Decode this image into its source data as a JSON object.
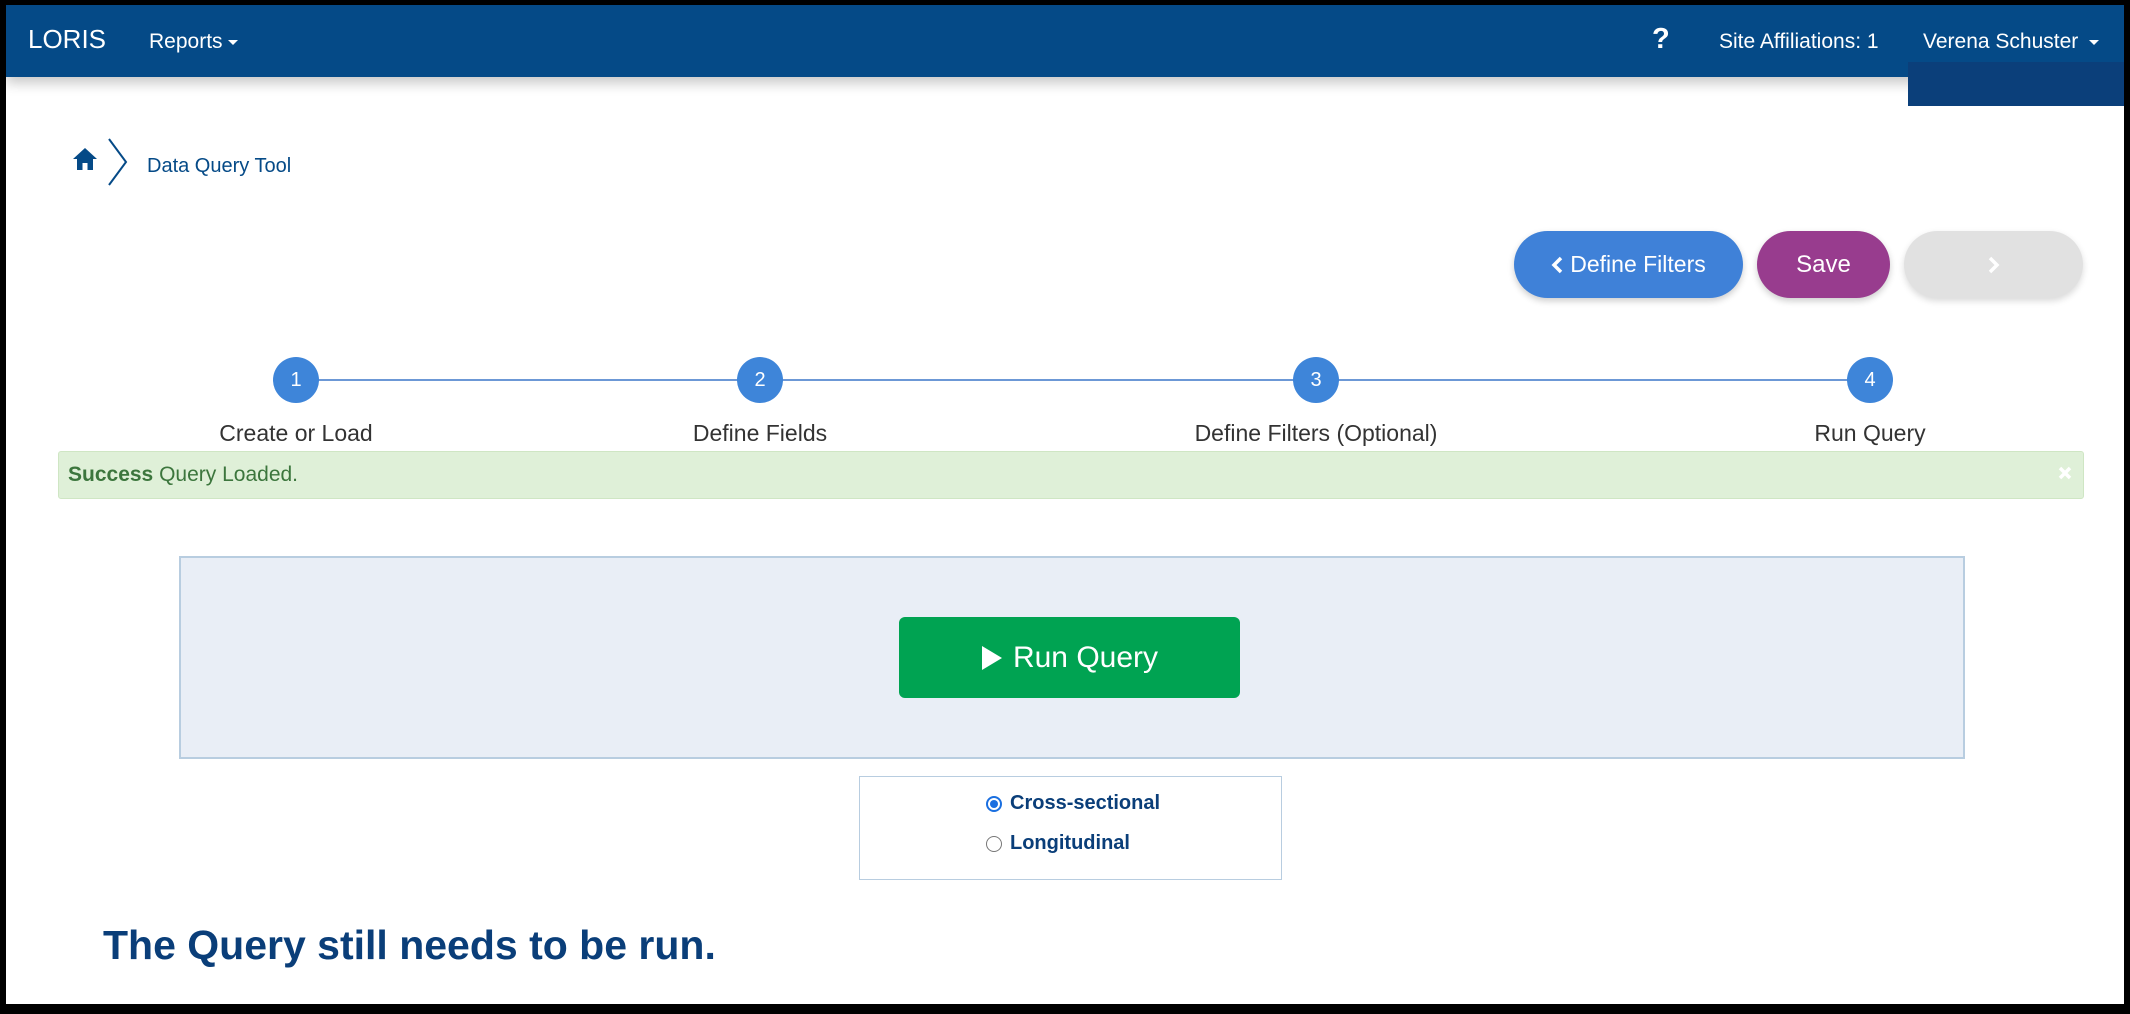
{
  "navbar": {
    "brand": "LORIS",
    "reports": "Reports",
    "help": "?",
    "site_affiliations": "Site Affiliations: 1",
    "user": "Verena Schuster"
  },
  "breadcrumb": {
    "current": "Data Query Tool"
  },
  "actions": {
    "define_filters": "Define Filters",
    "save": "Save"
  },
  "steps": [
    {
      "number": "1",
      "label": "Create or Load"
    },
    {
      "number": "2",
      "label": "Define Fields"
    },
    {
      "number": "3",
      "label": "Define Filters (Optional)"
    },
    {
      "number": "4",
      "label": "Run Query"
    }
  ],
  "alert": {
    "strong": "Success",
    "message": "Query Loaded."
  },
  "run": {
    "button_label": "Run Query"
  },
  "query_type": {
    "options": [
      "Cross-sectional",
      "Longitudinal"
    ],
    "selected": "Cross-sectional"
  },
  "status_message": "The Query still needs to be run.",
  "colors": {
    "navbar": "#054a87",
    "define_filters": "#3f81d8",
    "save": "#983c8e",
    "run": "#00a352",
    "step": "#3e85d9"
  }
}
